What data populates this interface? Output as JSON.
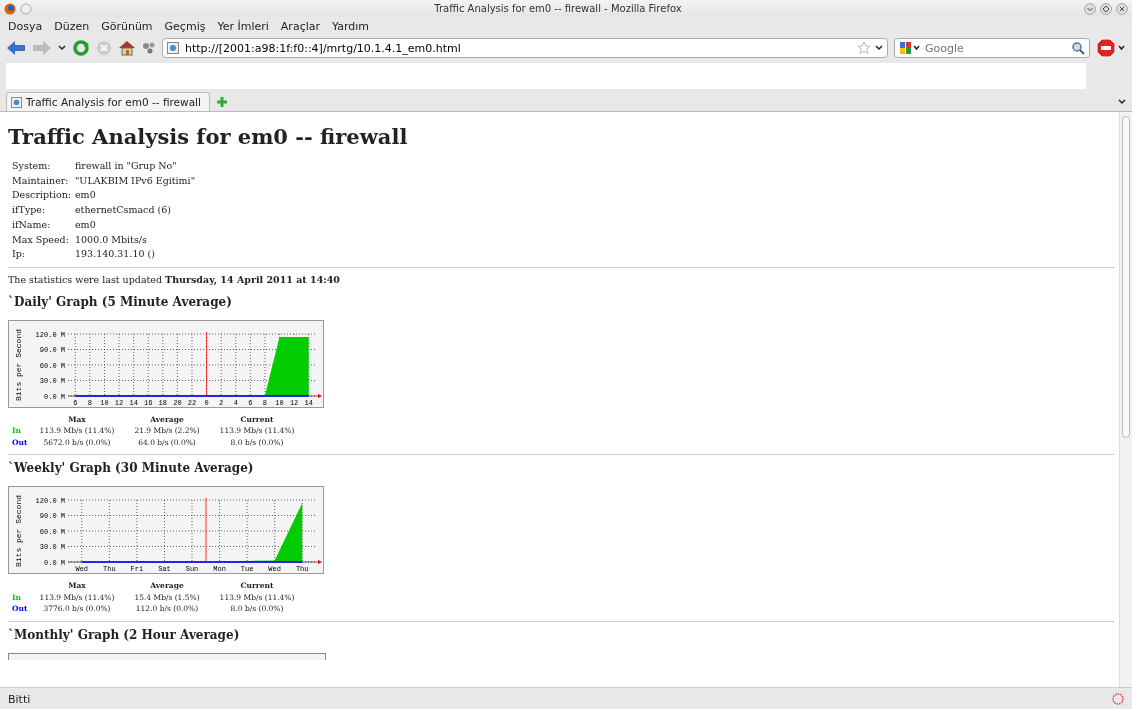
{
  "window": {
    "title": "Traffic Analysis for em0 -- firewall - Mozilla Firefox"
  },
  "menu": [
    "Dosya",
    "Düzen",
    "Görünüm",
    "Geçmiş",
    "Yer İmleri",
    "Araçlar",
    "Yardım"
  ],
  "address_bar": {
    "value": "http://[2001:a98:1f:f0::4]/mrtg/10.1.4.1_em0.html"
  },
  "search": {
    "placeholder": "Google"
  },
  "tabs": [
    {
      "label": "Traffic Analysis for em0 -- firewall",
      "selected": true
    }
  ],
  "page": {
    "heading": "Traffic Analysis for em0 -- firewall",
    "info": [
      {
        "label": "System:",
        "value": "firewall in \"Grup No\""
      },
      {
        "label": "Maintainer:",
        "value": "\"ULAKBIM IPv6 Egitimi\""
      },
      {
        "label": "Description:",
        "value": "em0"
      },
      {
        "label": "ifType:",
        "value": "ethernetCsmacd (6)"
      },
      {
        "label": "ifName:",
        "value": "em0"
      },
      {
        "label": "Max Speed:",
        "value": "1000.0 Mbits/s"
      },
      {
        "label": "Ip:",
        "value": "193.140.31.10 ()"
      }
    ],
    "updated": "The statistics were last updated **Thursday, 14 April 2011 at 14:40**",
    "graphs": [
      {
        "title": "`Daily' Graph (5 Minute Average)",
        "chart_data": {
          "type": "area",
          "ylabel": "Bits per Second",
          "categories": [
            "6",
            "8",
            "10",
            "12",
            "14",
            "16",
            "18",
            "20",
            "22",
            "0",
            "2",
            "4",
            "6",
            "8",
            "10",
            "12",
            "14"
          ],
          "series": [
            {
              "name": "In",
              "color": "#00cc00",
              "values": [
                1,
                1,
                1,
                1,
                1,
                1,
                1,
                1,
                1,
                1,
                1,
                1,
                1,
                1,
                114,
                114,
                114
              ]
            },
            {
              "name": "Out",
              "color": "#0000ff",
              "type": "line",
              "values": [
                0,
                0,
                0,
                0,
                0,
                0,
                0,
                0,
                0,
                0,
                0,
                0,
                0,
                0,
                0,
                0,
                0
              ]
            }
          ],
          "grid": true,
          "ylim": [
            0,
            120
          ],
          "yticks": [
            {
              "value": 0,
              "label": "0.0 M"
            },
            {
              "value": 30,
              "label": "30.0 M"
            },
            {
              "value": 60,
              "label": "60.0 M"
            },
            {
              "value": 90,
              "label": "90.0 M"
            },
            {
              "value": 120,
              "label": "120.0 M"
            }
          ],
          "ref_lines": [
            {
              "axis": "x",
              "value": "0",
              "color": "#ff0000"
            }
          ]
        },
        "stats": {
          "columns": [
            "Max",
            "Average",
            "Current"
          ],
          "rows": [
            {
              "values": [
                "113.9 Mb/s (11.4%)",
                "21.9 Mb/s (2.2%)",
                "113.9 Mb/s (11.4%)"
              ]
            },
            {
              "values": [
                "5672.0 b/s (0.0%)",
                "64.0 b/s (0.0%)",
                "8.0 b/s (0.0%)"
              ]
            }
          ]
        }
      },
      {
        "title": "`Weekly' Graph (30 Minute Average)",
        "chart_data": {
          "type": "area",
          "ylabel": "Bits per Second",
          "categories": [
            "Wed",
            "Thu",
            "Fri",
            "Sat",
            "Sun",
            "Mon",
            "Tue",
            "Wed",
            "Thu"
          ],
          "series": [
            {
              "name": "In",
              "color": "#00cc00",
              "values": [
                0,
                0,
                0,
                0,
                0,
                0,
                2,
                3,
                114
              ]
            },
            {
              "name": "Out",
              "color": "#0000ff",
              "type": "line",
              "values": [
                0,
                0,
                0,
                0,
                0,
                0,
                0,
                0,
                0
              ]
            }
          ],
          "grid": true,
          "ylim": [
            0,
            120
          ],
          "yticks": [
            {
              "value": 0,
              "label": "0.0 M"
            },
            {
              "value": 30,
              "label": "30.0 M"
            },
            {
              "value": 60,
              "label": "60.0 M"
            },
            {
              "value": 90,
              "label": "90.0 M"
            },
            {
              "value": 120,
              "label": "120.0 M"
            }
          ]
        },
        "stats": {
          "columns": [
            "Max",
            "Average",
            "Current"
          ],
          "rows": [
            {
              "values": [
                "113.9 Mb/s (11.4%)",
                "15.4 Mb/s (1.5%)",
                "113.9 Mb/s (11.4%)"
              ]
            },
            {
              "values": [
                "3776.0 b/s (0.0%)",
                "112.0 b/s (0.0%)",
                "8.0 b/s (0.0%)"
              ]
            }
          ]
        }
      },
      {
        "title": "`Monthly' Graph (2 Hour Average)"
      }
    ]
  },
  "status_bar": {
    "text": "Bitti"
  }
}
